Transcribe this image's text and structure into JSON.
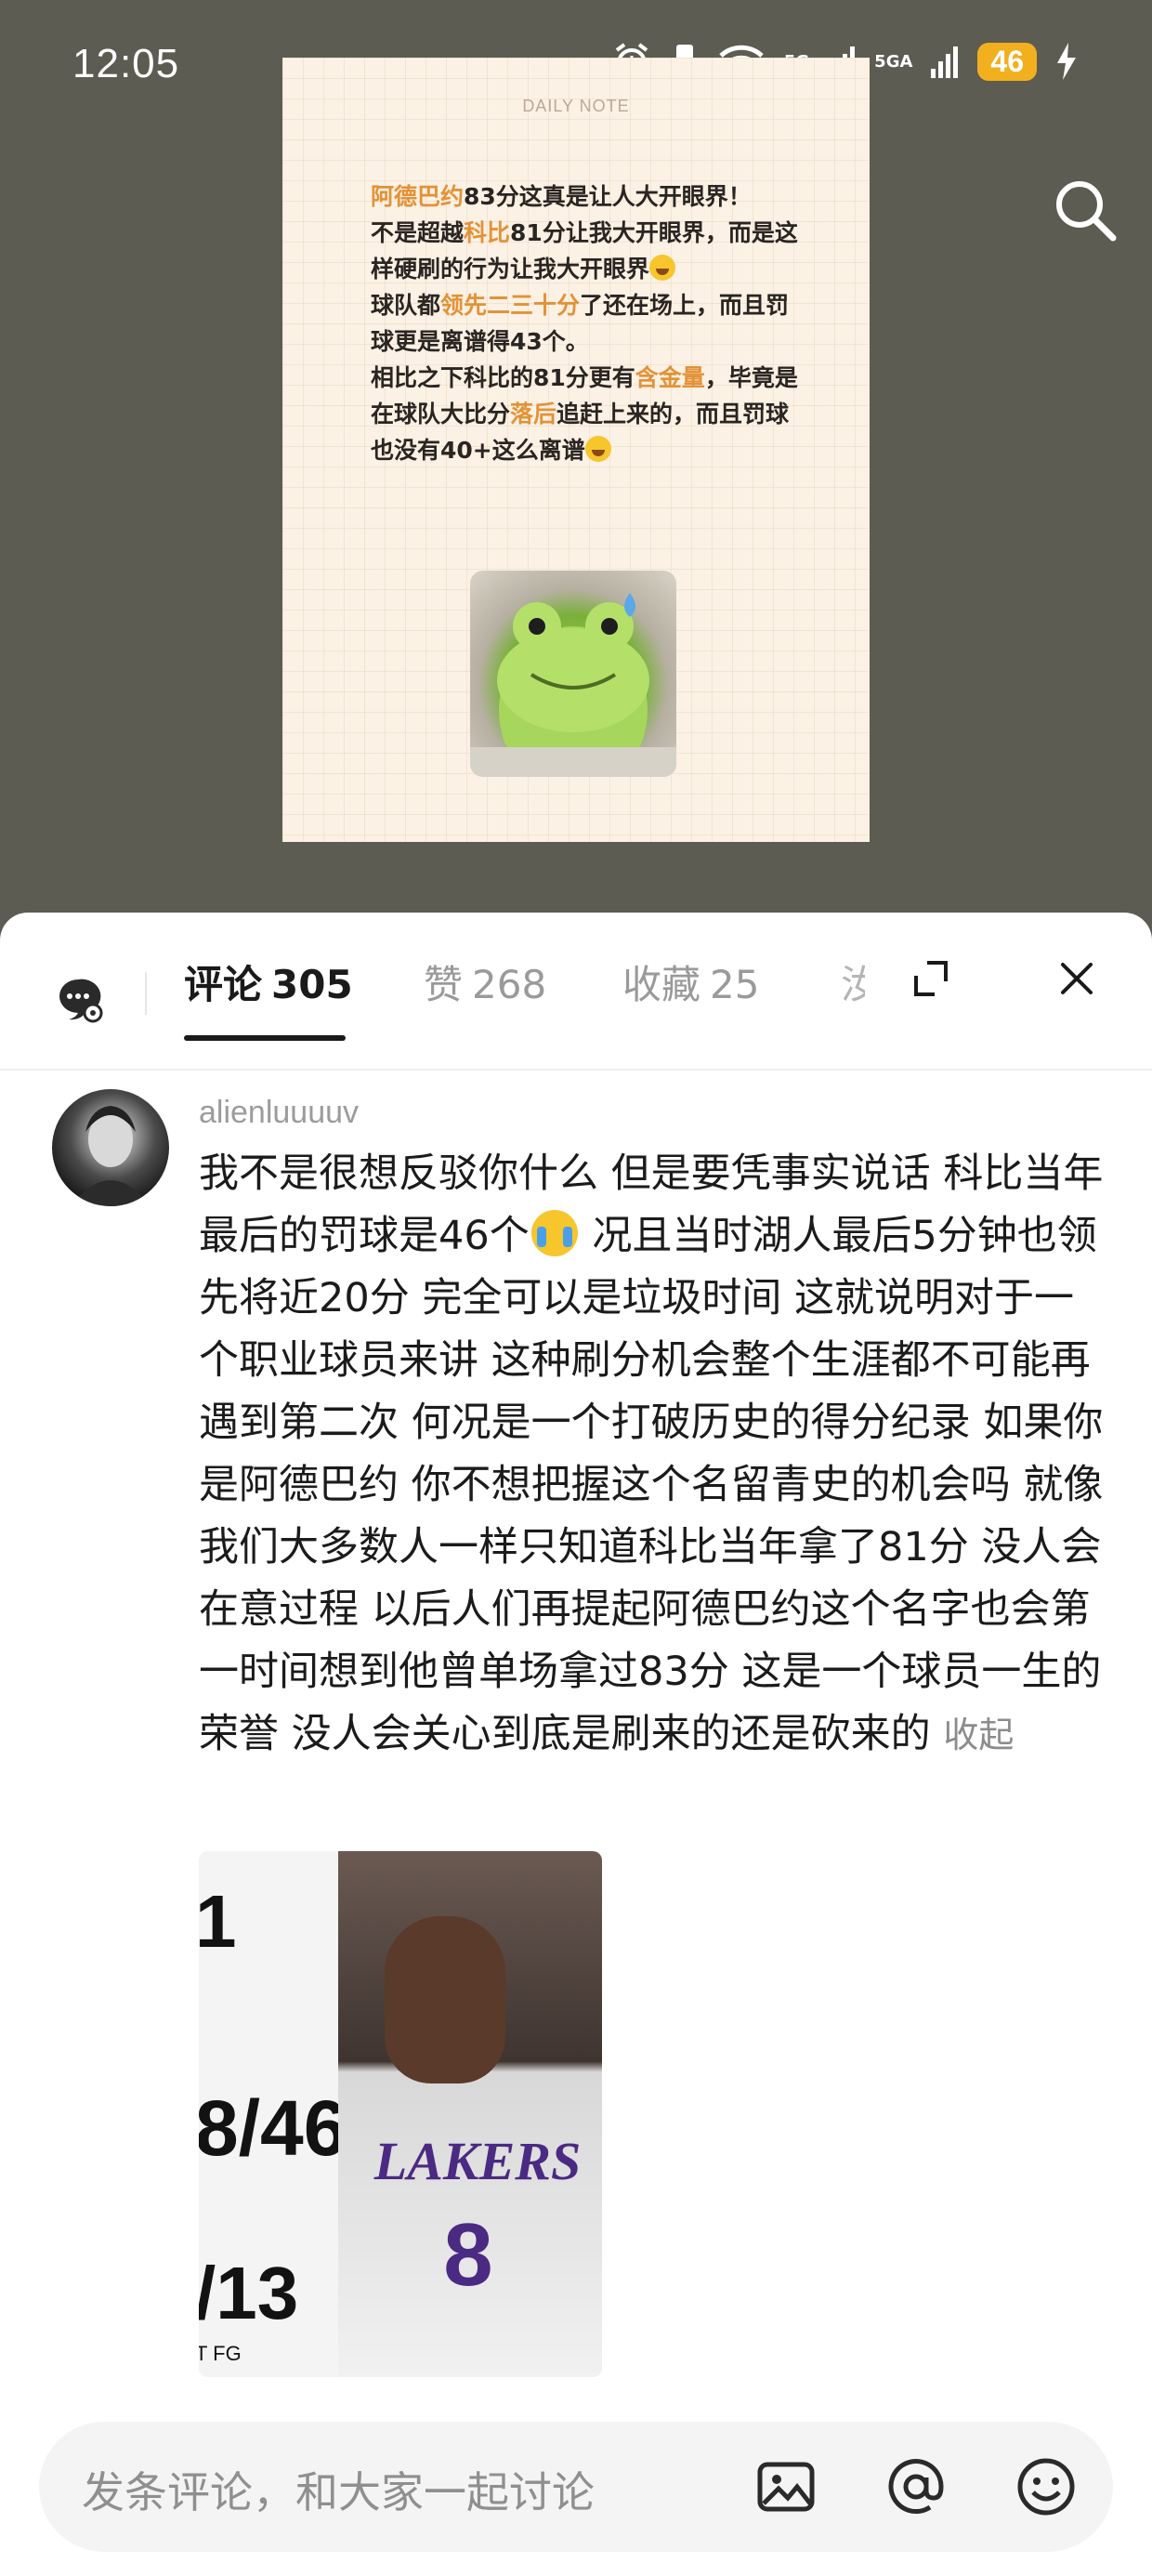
{
  "status_bar": {
    "time": "12:05",
    "battery": "46",
    "network1": "5G",
    "network2": "5GA"
  },
  "note": {
    "header": "DAILY NOTE",
    "p1": [
      {
        "t": "阿德巴约",
        "hl": true
      },
      {
        "t": "83分这真是让人大开眼界！",
        "hl": false
      }
    ],
    "p2": [
      {
        "t": "不是超越",
        "hl": false
      },
      {
        "t": "科比",
        "hl": true
      },
      {
        "t": "81分让我大开眼界，而是这样硬刷的行为让我大开眼界",
        "hl": false
      }
    ],
    "p3": [
      {
        "t": "球队都",
        "hl": false
      },
      {
        "t": "领先二三十分",
        "hl": true
      },
      {
        "t": "了还在场上，而且罚球更是离谱得43个。",
        "hl": false
      }
    ],
    "p4": [
      {
        "t": "相比之下科比的81分更有",
        "hl": false
      },
      {
        "t": "含金量",
        "hl": true
      },
      {
        "t": "，毕竟是在球队大比分",
        "hl": false
      },
      {
        "t": "落后",
        "hl": true
      },
      {
        "t": "追赶上来的，而且罚球也没有40+这么离谱",
        "hl": false
      }
    ]
  },
  "tabs": [
    {
      "label": "评论",
      "count": "305",
      "active": true
    },
    {
      "label": "赞",
      "count": "268",
      "active": false
    },
    {
      "label": "收藏",
      "count": "25",
      "active": false
    }
  ],
  "tab_truncated": "汝",
  "comment": {
    "username": "alienluuuuv",
    "text_part1": "我不是很想反驳你什么 但是要凭事实说话 科比当年最后的罚球是46个",
    "text_part2": " 况且当时湖人最后5分钟也领先将近20分 完全可以是垃圾时间 这就说明对于一个职业球员来讲 这种刷分机会整个生涯都不可能再遇到第二次 何况是一个打破历史的得分纪录 如果你是阿德巴约 你不想把握这个名留青史的机会吗 就像我们大多数人一样只知道科比当年拿了81分 没人会在意过程 以后人们再提起阿德巴约这个名字也会第一时间想到他曾单场拿过83分 这是一个球员一生的荣誉 没人会关心到底是刷来的还是砍来的",
    "collapse": "收起",
    "photo": {
      "stat1": "1",
      "stat2": "8/46",
      "stat3": "/13",
      "stat4": "T FG",
      "jersey_text": "LAKERS",
      "jersey_number": "8"
    }
  },
  "input": {
    "placeholder": "发条评论，和大家一起讨论"
  },
  "icons": [
    "search-icon",
    "ai-assistant-icon",
    "expand-icon",
    "close-icon",
    "image-icon",
    "at-icon",
    "emoji-icon"
  ]
}
